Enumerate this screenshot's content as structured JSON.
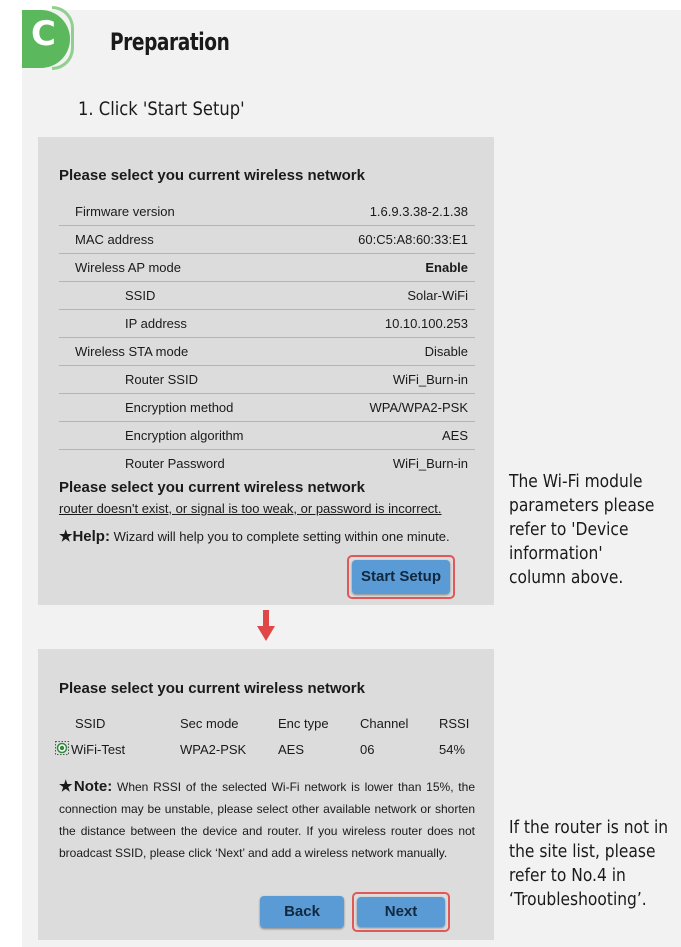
{
  "section": {
    "letter": "C",
    "title": "Preparation"
  },
  "step": {
    "text": "1. Click 'Start Setup'"
  },
  "panel1": {
    "heading": "Please select you current wireless network",
    "rows": [
      {
        "label": "Firmware version",
        "value": "1.6.9.3.38-2.1.38"
      },
      {
        "label": "MAC address",
        "value": "60:C5:A8:60:33:E1"
      },
      {
        "label": "Wireless AP mode",
        "value": "Enable"
      },
      {
        "label": "SSID",
        "value": "Solar-WiFi"
      },
      {
        "label": "IP address",
        "value": "10.10.100.253"
      },
      {
        "label": "Wireless STA mode",
        "value": "Disable"
      },
      {
        "label": "Router SSID",
        "value": "WiFi_Burn-in"
      },
      {
        "label": "Encryption method",
        "value": "WPA/WPA2-PSK"
      },
      {
        "label": "Encryption algorithm",
        "value": "AES"
      },
      {
        "label": "Router Password",
        "value": "WiFi_Burn-in"
      }
    ],
    "heading2": "Please select you current wireless network",
    "subtext": "router doesn't exist, or signal is too weak, or password is incorrect.",
    "help_label": "★Help:",
    "help_text": " Wizard will help you to complete setting within one minute.",
    "start_button": "Start Setup"
  },
  "panel2": {
    "heading": "Please select you current wireless network",
    "columns": [
      "SSID",
      "Sec mode",
      "Enc type",
      "Channel",
      "RSSI"
    ],
    "network": {
      "ssid": "WiFi-Test",
      "sec_mode": "WPA2-PSK",
      "enc_type": "AES",
      "channel": "06",
      "rssi": "54%"
    },
    "note_label": "★Note:",
    "note_text": " When RSSI of the selected Wi-Fi network is lower than 15%, the connection may be unstable, please select other available network or shorten the distance between the device and router. If you wireless router does not broadcast SSID, please click ‘Next’ and add a wireless network manually.",
    "back_button": "Back",
    "next_button": "Next"
  },
  "side_notes": {
    "note1": [
      "The Wi-Fi module",
      "parameters please",
      "refer to 'Device",
      "information'",
      "column above."
    ],
    "note2": [
      "If the router is not in",
      "the site list, please",
      "refer to No.4 in",
      "‘Troubleshooting’."
    ]
  },
  "colors": {
    "badge": "#5cb85c",
    "button": "#5b9bd5",
    "highlight": "#e05858",
    "arrow": "#e04848"
  }
}
